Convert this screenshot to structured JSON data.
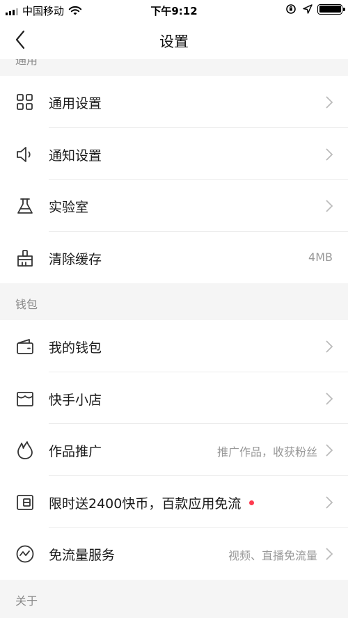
{
  "status_bar": {
    "carrier": "中国移动",
    "time": "下午9:12"
  },
  "nav": {
    "title": "设置"
  },
  "sections": {
    "general_header": "通用",
    "wallet_header": "钱包",
    "about_header": "关于"
  },
  "general": {
    "items": [
      {
        "label": "通用设置",
        "icon": "grid-icon"
      },
      {
        "label": "通知设置",
        "icon": "speaker-icon"
      },
      {
        "label": "实验室",
        "icon": "flask-icon"
      },
      {
        "label": "清除缓存",
        "icon": "broom-icon",
        "detail": "4MB"
      }
    ]
  },
  "wallet": {
    "items": [
      {
        "label": "我的钱包",
        "icon": "wallet-icon"
      },
      {
        "label": "快手小店",
        "icon": "store-icon"
      },
      {
        "label": "作品推广",
        "icon": "flame-icon",
        "detail": "推广作品，收获粉丝"
      },
      {
        "label": "限时送2400快币，百款应用免流",
        "icon": "sim-card-icon",
        "badge": "red-dot"
      },
      {
        "label": "免流量服务",
        "icon": "pulse-circle-icon",
        "detail": "视频、直播免流量"
      }
    ]
  },
  "colors": {
    "badge_dot": "#fe3b4f",
    "detail_text": "#999999",
    "section_bg": "#f5f5f5"
  }
}
